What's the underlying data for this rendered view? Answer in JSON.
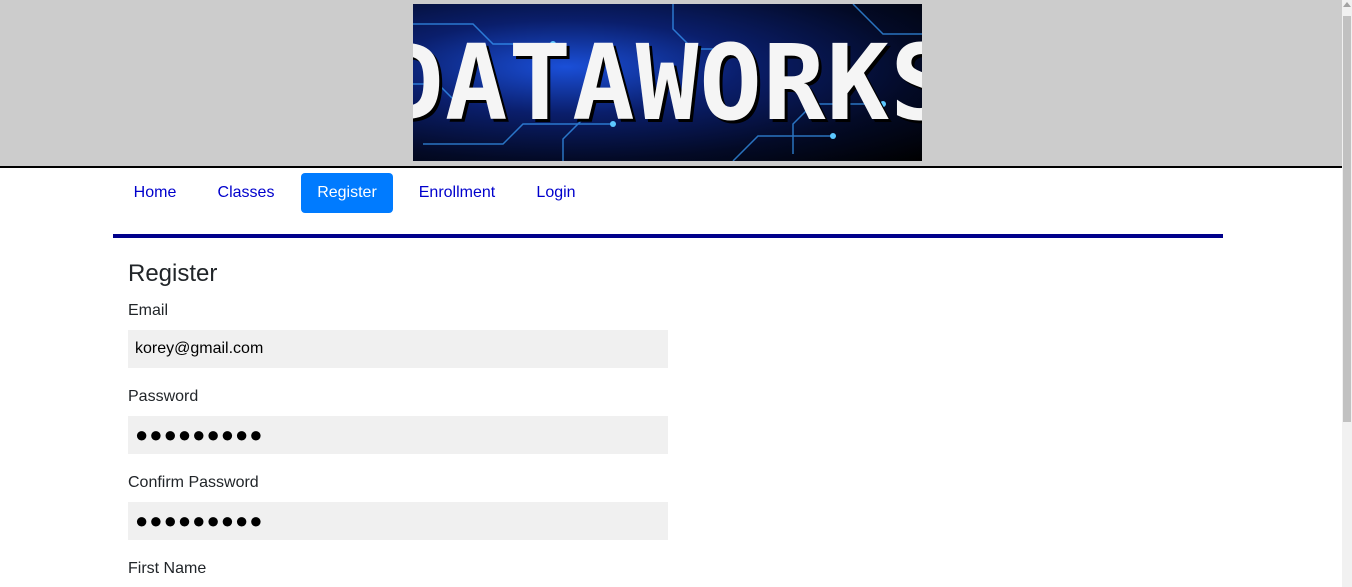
{
  "header": {
    "logo_text": "DATAWORKS",
    "logo_bg_color": "#050d2e",
    "band_color": "#cccccc"
  },
  "nav": {
    "items": [
      {
        "label": "Home"
      },
      {
        "label": "Classes"
      },
      {
        "label": "Register"
      },
      {
        "label": "Enrollment"
      },
      {
        "label": "Login"
      }
    ],
    "active_index": 2,
    "active_color": "#007bff",
    "link_color": "#0000cc",
    "underline_color": "#00008b"
  },
  "form": {
    "title": "Register",
    "email_label": "Email",
    "email_value": "korey@gmail.com",
    "password_label": "Password",
    "password_value": "●●●●●●●●●",
    "confirm_label": "Confirm Password",
    "confirm_value": "●●●●●●●●●",
    "first_name_label": "First Name"
  }
}
